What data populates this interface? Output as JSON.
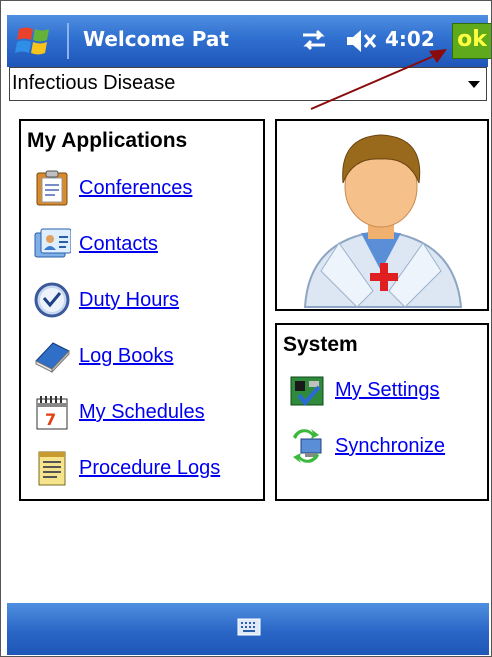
{
  "titlebar": {
    "title": "Welcome Pat",
    "time": "4:02",
    "ok_label": "ok"
  },
  "dropdown": {
    "selected": "Infectious Disease"
  },
  "applications": {
    "heading": "My Applications",
    "items": [
      {
        "label": "Conferences",
        "icon": "clipboard-icon"
      },
      {
        "label": "Contacts",
        "icon": "contacts-card-icon"
      },
      {
        "label": "Duty Hours",
        "icon": "clock-icon"
      },
      {
        "label": "Log Books",
        "icon": "book-icon"
      },
      {
        "label": "My Schedules",
        "icon": "calendar-icon"
      },
      {
        "label": "Procedure Logs",
        "icon": "notepad-icon"
      }
    ]
  },
  "system": {
    "heading": "System",
    "items": [
      {
        "label": "My Settings",
        "icon": "settings-card-icon"
      },
      {
        "label": "Synchronize",
        "icon": "sync-icon"
      }
    ]
  },
  "colors": {
    "link": "#0000ee",
    "titlebar": "#2f6fd0",
    "ok_button": "#5eaa1c",
    "annotation_arrow": "#8b0a0a"
  }
}
